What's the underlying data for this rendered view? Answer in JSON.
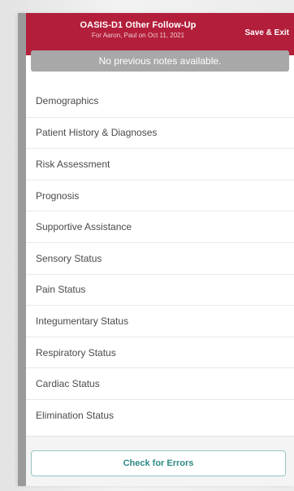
{
  "header": {
    "title": "OASIS-D1 Other Follow-Up",
    "subtitle": "For Aaron, Paul on Oct 11, 2021",
    "save_exit_label": "Save & Exit"
  },
  "notes_banner": "No previous notes available.",
  "menu": {
    "items": [
      {
        "label": "Demographics"
      },
      {
        "label": "Patient History & Diagnoses"
      },
      {
        "label": "Risk Assessment"
      },
      {
        "label": "Prognosis"
      },
      {
        "label": "Supportive Assistance"
      },
      {
        "label": "Sensory Status"
      },
      {
        "label": "Pain Status"
      },
      {
        "label": "Integumentary Status"
      },
      {
        "label": "Respiratory Status"
      },
      {
        "label": "Cardiac Status"
      },
      {
        "label": "Elimination Status"
      }
    ]
  },
  "footer": {
    "check_errors_label": "Check for Errors"
  },
  "colors": {
    "header_bg": "#b31f3b",
    "banner_bg": "#a8a8a8",
    "button_text": "#2e8a86"
  }
}
